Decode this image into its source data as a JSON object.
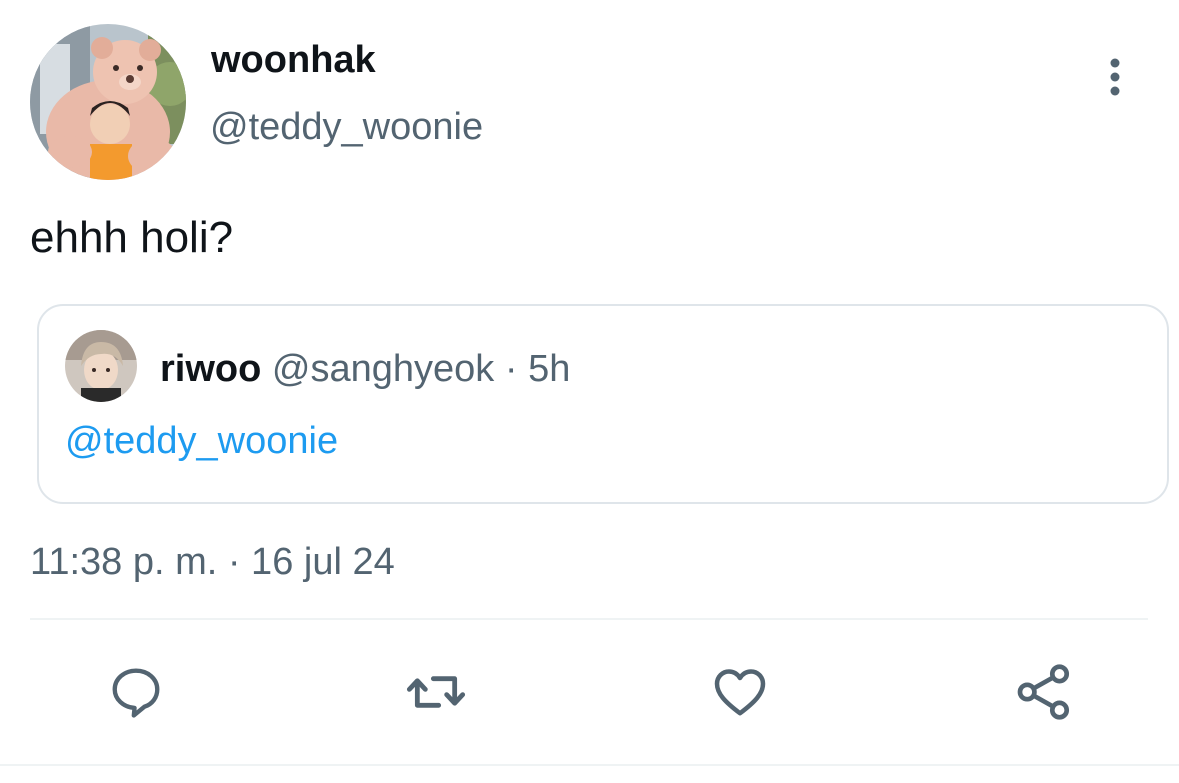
{
  "tweet": {
    "author": {
      "name": "woonhak",
      "handle": "@teddy_woonie",
      "avatar_icon": "teddy-bear-photo-avatar"
    },
    "more_icon": "more-vertical-icon",
    "text": "ehhh holi?",
    "quoted_tweet": {
      "author_name": "riwoo",
      "author_handle": "@sanghyeok",
      "separator": " · ",
      "age": "5h",
      "mention": "@teddy_woonie",
      "avatar_icon": "person-photo-avatar"
    },
    "timestamp": "11:38 p. m. · 16 jul 24"
  },
  "actions": [
    {
      "name": "reply",
      "icon": "reply-icon"
    },
    {
      "name": "retweet",
      "icon": "retweet-icon"
    },
    {
      "name": "like",
      "icon": "heart-icon"
    },
    {
      "name": "share",
      "icon": "share-icon"
    }
  ],
  "colors": {
    "text_primary": "#0f1419",
    "text_secondary": "#536471",
    "link": "#1d9bf0",
    "border": "#dfe5ea",
    "divider": "#eff3f4"
  }
}
